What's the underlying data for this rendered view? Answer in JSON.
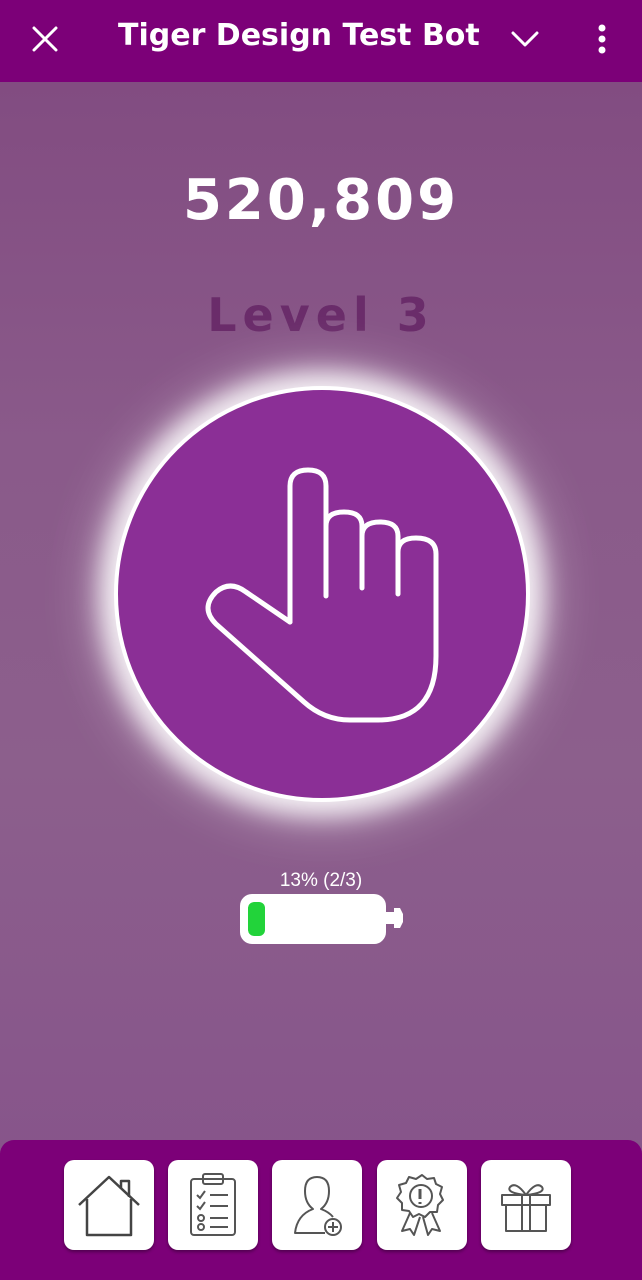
{
  "header": {
    "title": "Tiger Design Test Bot",
    "close_icon": "close-icon",
    "chevron_icon": "chevron-down-icon",
    "menu_icon": "more-vert-icon"
  },
  "game": {
    "score": "520,809",
    "level": "Level 3",
    "tap_icon": "pointing-hand-icon"
  },
  "energy": {
    "label": "13% (2/3)",
    "percent": 13
  },
  "nav": {
    "items": [
      {
        "icon": "home-icon"
      },
      {
        "icon": "clipboard-checklist-icon"
      },
      {
        "icon": "add-user-icon"
      },
      {
        "icon": "award-badge-icon"
      },
      {
        "icon": "gift-icon"
      }
    ]
  },
  "colors": {
    "header_bg": "#7c0078",
    "circle_bg": "#8b2f96",
    "level_text": "#6a2c6a",
    "battery_fill": "#22d33a"
  }
}
